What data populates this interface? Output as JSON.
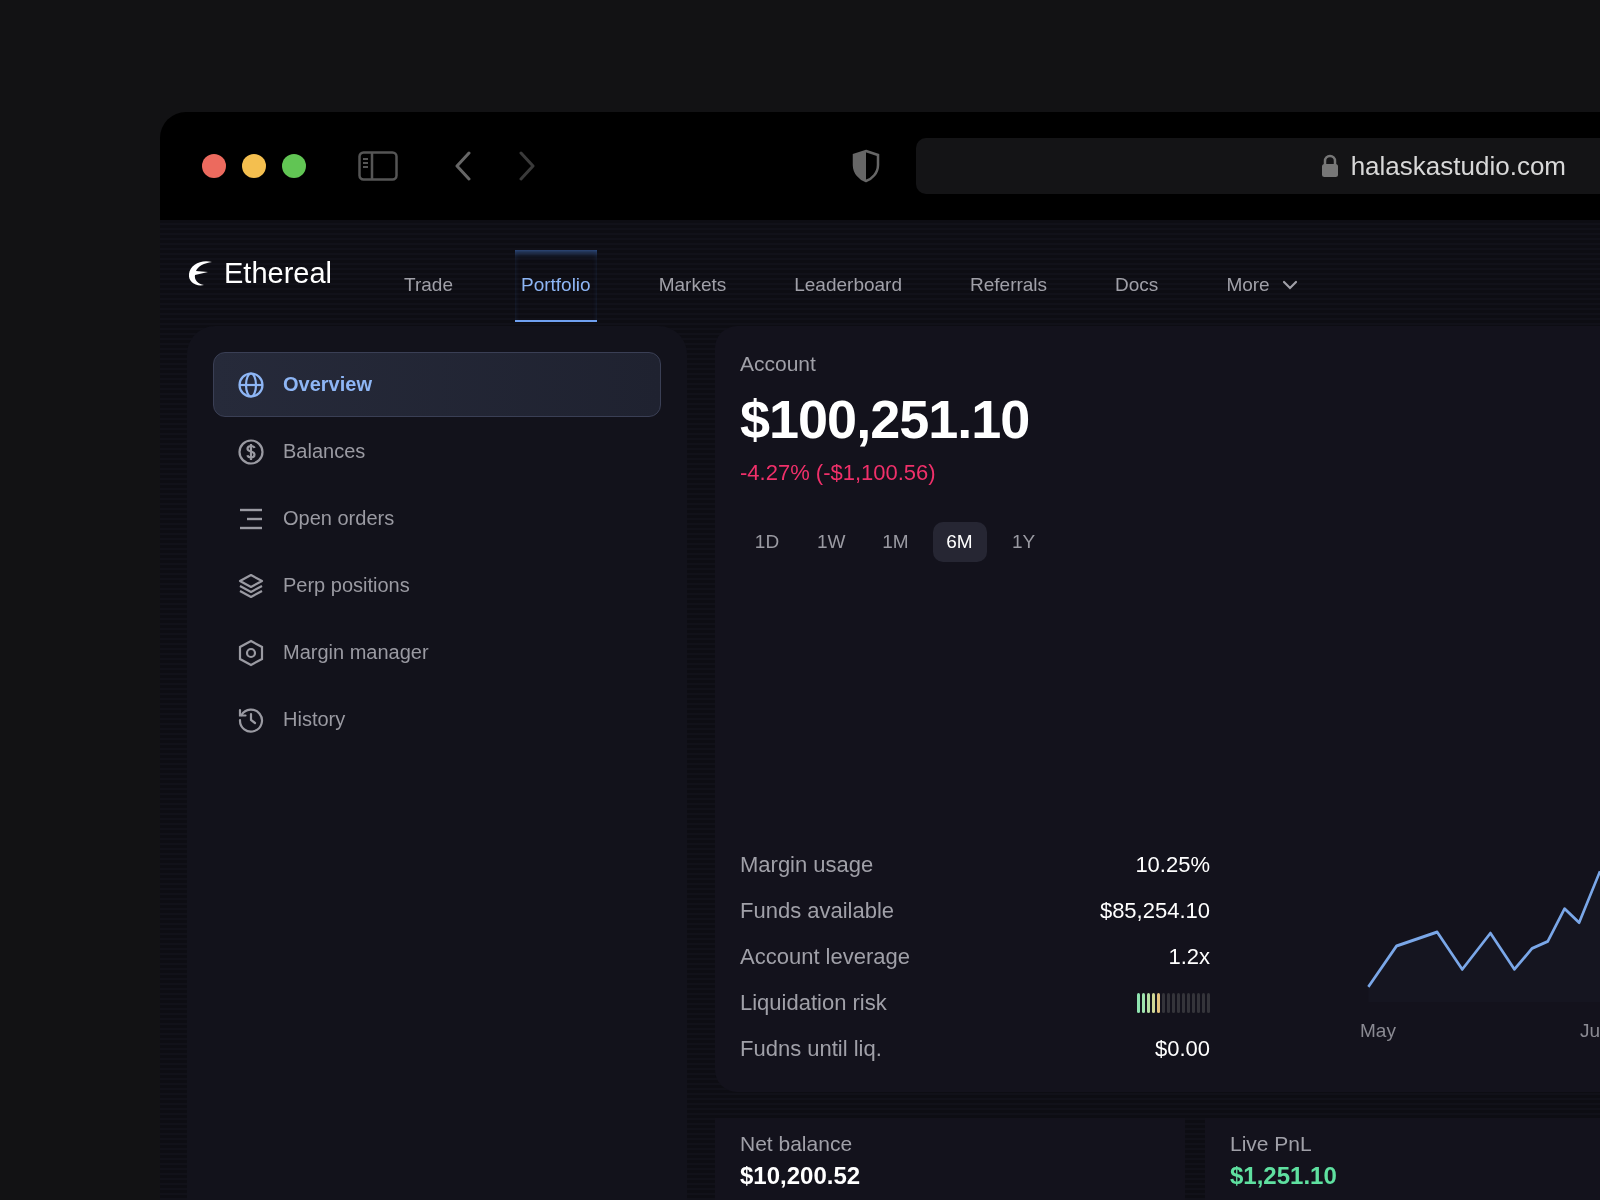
{
  "browser": {
    "url": "halaskastudio.com"
  },
  "brand": "Ethereal",
  "nav": [
    {
      "label": "Trade",
      "selected": false,
      "kind": "link"
    },
    {
      "label": "Portfolio",
      "selected": true,
      "kind": "link"
    },
    {
      "label": "Markets",
      "selected": false,
      "kind": "link"
    },
    {
      "label": "Leaderboard",
      "selected": false,
      "kind": "link"
    },
    {
      "label": "Referrals",
      "selected": false,
      "kind": "link"
    },
    {
      "label": "Docs",
      "selected": false,
      "kind": "link"
    },
    {
      "label": "More",
      "selected": false,
      "kind": "dropdown"
    }
  ],
  "sidebar": {
    "items": [
      {
        "label": "Overview",
        "selected": true
      },
      {
        "label": "Balances",
        "selected": false
      },
      {
        "label": "Open orders",
        "selected": false
      },
      {
        "label": "Perp positions",
        "selected": false
      },
      {
        "label": "Margin manager",
        "selected": false
      },
      {
        "label": "History",
        "selected": false
      }
    ]
  },
  "account": {
    "title": "Account",
    "balance": "$100,251.10",
    "change": "-4.27% (-$1,100.56)",
    "ranges": [
      {
        "label": "1D",
        "selected": false
      },
      {
        "label": "1W",
        "selected": false
      },
      {
        "label": "1M",
        "selected": false
      },
      {
        "label": "6M",
        "selected": true
      },
      {
        "label": "1Y",
        "selected": false
      }
    ],
    "stats": [
      {
        "label": "Margin usage",
        "kind": "text",
        "value": "10.25%"
      },
      {
        "label": "Funds available",
        "kind": "text",
        "value": "$85,254.10"
      },
      {
        "label": "Account leverage",
        "kind": "text",
        "value": "1.2x"
      },
      {
        "label": "Liquidation risk",
        "kind": "meter",
        "level": 0.33
      },
      {
        "label": "Fudns until liq.",
        "kind": "text",
        "value": "$0.00"
      }
    ],
    "chart": {
      "x_labels": [
        "May",
        "Ju"
      ]
    }
  },
  "summary": [
    {
      "label": "Net balance",
      "value": "$10,200.52",
      "color": "#ffffff"
    },
    {
      "label": "Live PnL",
      "value": "$1,251.10",
      "color": "#5fe0a0"
    }
  ]
}
